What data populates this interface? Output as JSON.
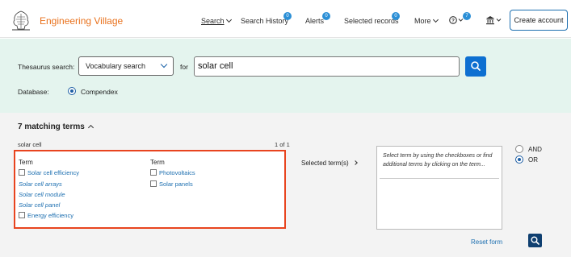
{
  "header": {
    "brand": "Engineering Village",
    "nav": {
      "search": "Search",
      "search_history": "Search History",
      "search_history_badge": "0",
      "alerts": "Alerts",
      "alerts_badge": "0",
      "selected_records": "Selected records",
      "selected_records_badge": "0",
      "more": "More",
      "help_badge": "7"
    },
    "create_account": "Create account"
  },
  "search": {
    "thesaurus_label": "Thesaurus search:",
    "type_value": "Vocabulary search",
    "for_label": "for",
    "query": "solar cell",
    "database_label": "Database:",
    "database_option": "Compendex"
  },
  "results": {
    "matching_terms": "7 matching terms",
    "query_label": "solar cell",
    "page_info": "1 of 1",
    "column1_header": "Term",
    "column2_header": "Term",
    "column1_terms": [
      {
        "label": "Solar cell efficiency",
        "style": "checkbox"
      },
      {
        "label": "Solar cell arrays",
        "style": "italic"
      },
      {
        "label": "Solar cell module",
        "style": "italic"
      },
      {
        "label": "Solar cell panel",
        "style": "italic"
      },
      {
        "label": "Energy efficiency",
        "style": "checkbox"
      }
    ],
    "column2_terms": [
      {
        "label": "Photovoltaics",
        "style": "checkbox"
      },
      {
        "label": "Solar panels",
        "style": "checkbox"
      }
    ],
    "selected_terms_label": "Selected term(s)",
    "selected_hint": "Select term by using the checkboxes or find additional terms by clicking on the term...",
    "operator_and": "AND",
    "operator_or": "OR",
    "reset_form": "Reset form"
  },
  "colors": {
    "brand": "#e9711c",
    "accent": "#0d6fd1",
    "search_panel_bg": "#e4f4ee",
    "highlight_border": "#e8441f"
  }
}
